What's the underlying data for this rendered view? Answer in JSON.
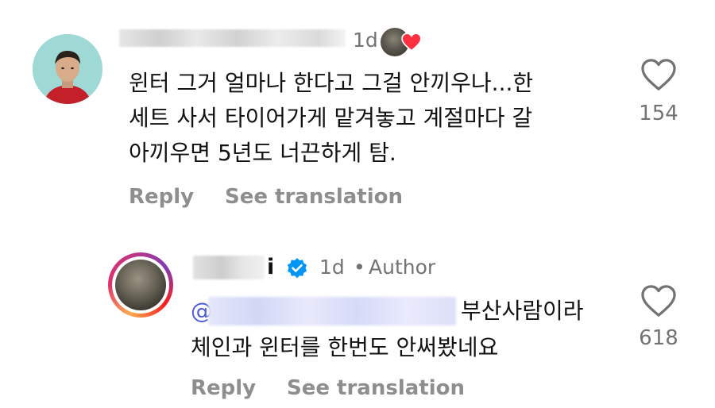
{
  "comment1": {
    "time": "1d",
    "text": "윈터 그거 얼마나 한다고 그걸 안끼우나...한\n세트 사서 타이어가게 맡겨놓고 계절마다 갈\n아끼우면 5년도 너끈하게 탐.",
    "likes": "154",
    "reply_label": "Reply",
    "translate_label": "See translation",
    "like_icon": "heart-outline-icon",
    "liked_by_author_icon": "red-heart-icon"
  },
  "comment2": {
    "username_tail": "i",
    "time": "1d",
    "separator": "•",
    "author_label": "Author",
    "mention_at": "@",
    "text_line1": "부산사람이라",
    "text_line2": "체인과 윈터를 한번도 안써봤네요",
    "likes": "618",
    "reply_label": "Reply",
    "translate_label": "See translation",
    "verified_icon": "verified-badge-icon",
    "like_icon": "heart-outline-icon"
  },
  "colors": {
    "secondary_text": "#737373",
    "action_text": "#8e8e8e",
    "mention": "#4a5bd8",
    "verified_blue": "#0095f6",
    "like_red": "#ff3040"
  }
}
